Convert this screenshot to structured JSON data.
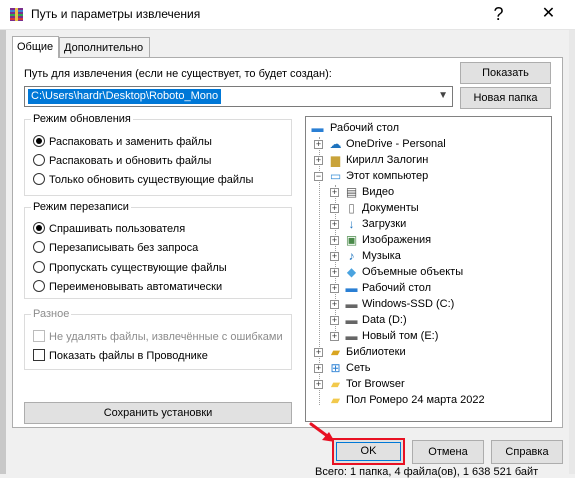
{
  "window": {
    "title": "Путь и параметры извлечения",
    "help_glyph": "?",
    "close_glyph": "✕"
  },
  "tabs": [
    {
      "label": "Общие"
    },
    {
      "label": "Дополнительно"
    }
  ],
  "path": {
    "label": "Путь для извлечения (если не существует, то будет создан):",
    "value": "C:\\Users\\hardr\\Desktop\\Roboto_Mono"
  },
  "buttons": {
    "show": "Показать",
    "new_folder": "Новая папка",
    "save_settings": "Сохранить установки",
    "ok": "OK",
    "cancel": "Отмена",
    "help": "Справка"
  },
  "update_mode": {
    "title": "Режим обновления",
    "options": [
      "Распаковать и заменить файлы",
      "Распаковать и обновить файлы",
      "Только обновить существующие файлы"
    ],
    "selected": 0
  },
  "overwrite_mode": {
    "title": "Режим перезаписи",
    "options": [
      "Спрашивать пользователя",
      "Перезаписывать без запроса",
      "Пропускать существующие файлы",
      "Переименовывать автоматически"
    ],
    "selected": 0
  },
  "misc": {
    "title": "Разное",
    "options": [
      {
        "label": "Не удалять файлы, извлечённые с ошибками",
        "checked": false,
        "disabled": true
      },
      {
        "label": "Показать файлы в Проводнике",
        "checked": false,
        "disabled": false
      }
    ]
  },
  "tree": [
    {
      "label": "Рабочий стол",
      "icon": "desktop-icon"
    },
    {
      "label": "OneDrive - Personal",
      "icon": "cloud-icon"
    },
    {
      "label": "Кирилл Залогин",
      "icon": "user-icon"
    },
    {
      "label": "Этот компьютер",
      "icon": "computer-icon"
    },
    {
      "label": "Видео",
      "icon": "video-icon"
    },
    {
      "label": "Документы",
      "icon": "documents-icon"
    },
    {
      "label": "Загрузки",
      "icon": "downloads-icon"
    },
    {
      "label": "Изображения",
      "icon": "pictures-icon"
    },
    {
      "label": "Музыка",
      "icon": "music-icon"
    },
    {
      "label": "Объемные объекты",
      "icon": "3d-objects-icon"
    },
    {
      "label": "Рабочий стол",
      "icon": "desktop-icon"
    },
    {
      "label": "Windows-SSD (C:)",
      "icon": "drive-icon"
    },
    {
      "label": "Data (D:)",
      "icon": "drive-icon"
    },
    {
      "label": "Новый том (E:)",
      "icon": "drive-icon"
    },
    {
      "label": "Библиотеки",
      "icon": "library-icon"
    },
    {
      "label": "Сеть",
      "icon": "network-icon"
    },
    {
      "label": "Tor Browser",
      "icon": "folder-icon"
    },
    {
      "label": "Пол Ромеро 24 марта 2022",
      "icon": "folder-icon"
    }
  ],
  "status_bar": {
    "text": "Всего: 1 папка, 4 файла(ов), 1 638 521 байт"
  },
  "colors": {
    "accent": "#0078d7",
    "highlight": "#e81123",
    "folder": "#f2c94c"
  }
}
